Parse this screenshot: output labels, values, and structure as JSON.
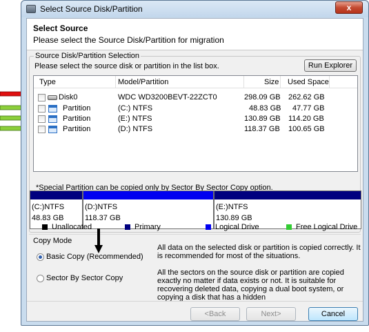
{
  "window": {
    "title": "Select Source Disk/Partition",
    "close_symbol": "x"
  },
  "header": {
    "title": "Select Source",
    "subtitle": "Please select the Source Disk/Partition for migration"
  },
  "selection": {
    "group_label": "Source Disk/Partition Selection",
    "instruction": "Please select the source disk or partition in the list box.",
    "run_explorer_label": "Run Explorer",
    "columns": [
      "Type",
      "Model/Partition",
      "Size",
      "Used Space"
    ],
    "rows": [
      {
        "type": "Disk0",
        "model": "WDC WD3200BEVT-22ZCT0",
        "size": "298.09 GB",
        "used": "262.62 GB",
        "icon": "disk-icon"
      },
      {
        "type": "Partition",
        "model": "(C:)  NTFS",
        "size": "48.83 GB",
        "used": "47.77 GB",
        "icon": "partition-icon"
      },
      {
        "type": "Partition",
        "model": "(E:)  NTFS",
        "size": "130.89 GB",
        "used": "114.20 GB",
        "icon": "partition-icon"
      },
      {
        "type": "Partition",
        "model": "(D:)  NTFS",
        "size": "118.37 GB",
        "used": "100.65 GB",
        "icon": "partition-icon"
      }
    ],
    "note": "*Special Partition can be copied only by Sector By Sector Copy option."
  },
  "disk_map": {
    "segments": [
      {
        "label": "(C:)NTFS",
        "size": "48.83 GB",
        "kind": "primary"
      },
      {
        "label": "(D:)NTFS",
        "size": "118.37 GB",
        "kind": "logical"
      },
      {
        "label": "(E:)NTFS",
        "size": "130.89 GB",
        "kind": "primary"
      }
    ]
  },
  "legend": [
    {
      "label": "Unallocated",
      "color": "#000000"
    },
    {
      "label": "Primary",
      "color": "#00007f"
    },
    {
      "label": "Logical Drive",
      "color": "#0000f0"
    },
    {
      "label": "Free Logical Drive",
      "color": "#33cc33"
    }
  ],
  "copy_mode": {
    "label": "Copy Mode",
    "options": [
      {
        "label": "Basic Copy (Recommended)",
        "selected": true,
        "description": "All data on the selected disk or partition is copied correctly. It is recommended for most of the situations."
      },
      {
        "label": "Sector By Sector Copy",
        "selected": false,
        "description": "All the sectors on the source disk or partition are copied exactly no matter if data exists or not. It is suitable for recovering deleted data, copying a dual boot system, or copying a disk that has a hidden"
      }
    ]
  },
  "footer": {
    "back_label": "<Back",
    "next_label": "Next>",
    "cancel_label": "Cancel"
  },
  "colors": {
    "red_arrow": "#e01010",
    "green_arrow": "#8ccf3a"
  }
}
